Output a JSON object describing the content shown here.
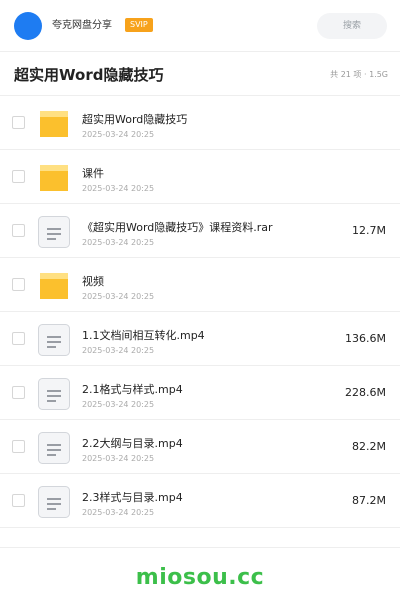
{
  "header": {
    "username": "夸克网盘分享",
    "badge": "SVIP",
    "search_placeholder": "搜索"
  },
  "folder": {
    "title": "超实用Word隐藏技巧",
    "summary": "共 21 项 · 1.5G"
  },
  "items": [
    {
      "name": "超实用Word隐藏技巧",
      "date": "2025-03-24 20:25",
      "size": "",
      "icon": "folder-icon"
    },
    {
      "name": "课件",
      "date": "2025-03-24 20:25",
      "size": "",
      "icon": "folder-icon"
    },
    {
      "name": "《超实用Word隐藏技巧》课程资料.rar",
      "date": "2025-03-24 20:25",
      "size": "12.7M",
      "icon": "file-icon"
    },
    {
      "name": "视频",
      "date": "2025-03-24 20:25",
      "size": "",
      "icon": "folder-icon"
    },
    {
      "name": "1.1文档间相互转化.mp4",
      "date": "2025-03-24 20:25",
      "size": "136.6M",
      "icon": "file-icon"
    },
    {
      "name": "2.1格式与样式.mp4",
      "date": "2025-03-24 20:25",
      "size": "228.6M",
      "icon": "file-icon"
    },
    {
      "name": "2.2大纲与目录.mp4",
      "date": "2025-03-24 20:25",
      "size": "82.2M",
      "icon": "file-icon"
    },
    {
      "name": "2.3样式与目录.mp4",
      "date": "2025-03-24 20:25",
      "size": "87.2M",
      "icon": "file-icon"
    }
  ],
  "watermark": "miosou.cc",
  "colors": {
    "accent": "#1e7cf2",
    "svip": "#f7a21b",
    "folder": "#fbc02d",
    "watermark": "#3cbf4a"
  }
}
